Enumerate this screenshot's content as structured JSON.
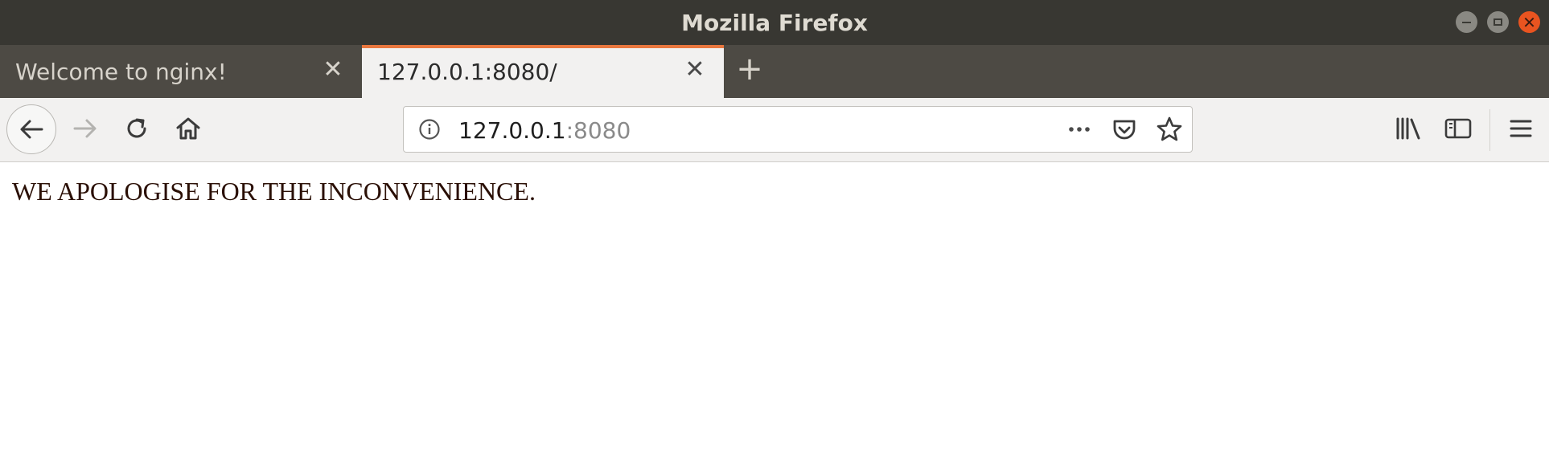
{
  "window": {
    "title": "Mozilla Firefox",
    "controls": [
      "minimize-icon",
      "maximize-icon",
      "close-icon"
    ]
  },
  "tabs": [
    {
      "label": "Welcome to nginx!",
      "active": false
    },
    {
      "label": "127.0.0.1:8080/",
      "active": true
    }
  ],
  "new_tab_icon": "plus-icon",
  "toolbar": {
    "url_host": "127.0.0.1",
    "url_port": ":8080",
    "icons": [
      "back-arrow-icon",
      "forward-arrow-icon",
      "reload-icon",
      "home-icon",
      "info-icon",
      "more-actions-icon",
      "pocket-icon",
      "bookmark-star-icon",
      "library-icon",
      "sidebar-icon",
      "hamburger-menu-icon"
    ]
  },
  "colors": {
    "titlebar": "#383732",
    "tabstrip": "#4d4a44",
    "active_tab_accent": "#e9773e",
    "close_button": "#e95420",
    "toolbar": "#f2f1f0",
    "message_text": "#2a0f05"
  },
  "page": {
    "message": "WE APOLOGISE FOR THE INCONVENIENCE."
  }
}
